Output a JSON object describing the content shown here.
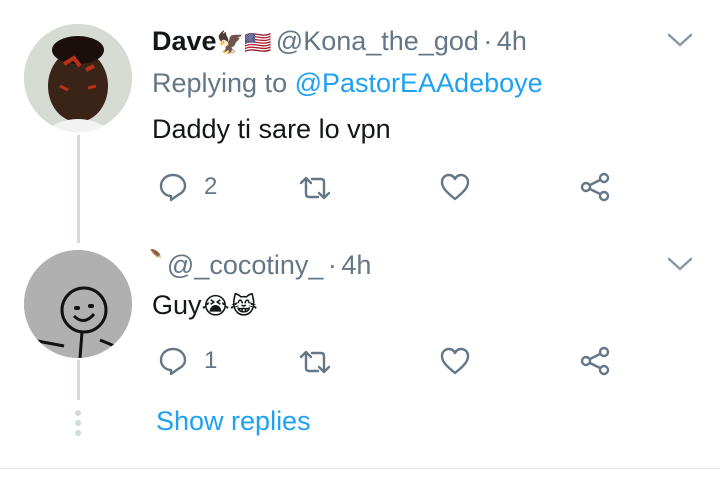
{
  "tweets": [
    {
      "name": "Dave",
      "name_emojis": "🦅🇺🇸",
      "handle": "@Kona_the_god",
      "separator": "·",
      "time": "4h",
      "replying_prefix": "Replying to",
      "replying_to": "@PastorEAAdeboye",
      "text": "Daddy ti sare lo vpn",
      "reply_count": "2",
      "retweet_count": "",
      "like_count": ""
    },
    {
      "name": "",
      "name_emojis": "🪶",
      "handle": "@_cocotiny_",
      "separator": "·",
      "time": "4h",
      "text": "Guy",
      "text_emojis": "😭😹",
      "reply_count": "1",
      "retweet_count": "",
      "like_count": ""
    }
  ],
  "show_replies_label": "Show replies",
  "colors": {
    "accent": "#1da1f2",
    "muted": "#657786",
    "thread_line": "#cfd9de"
  },
  "icons": [
    "chevron-down-icon",
    "reply-icon",
    "retweet-icon",
    "like-icon",
    "share-icon"
  ]
}
